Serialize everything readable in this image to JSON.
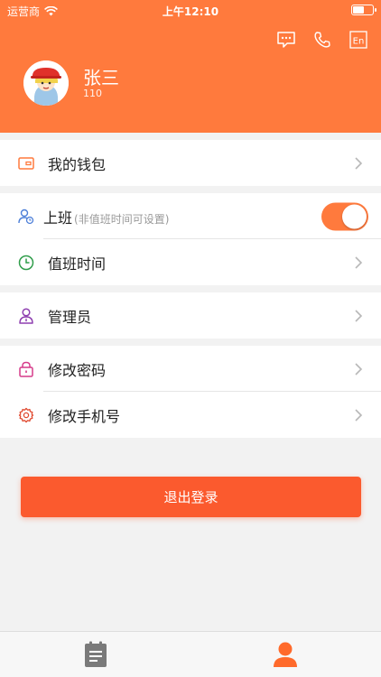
{
  "status_bar": {
    "carrier": "运营商",
    "time": "上午12:10",
    "battery_level": 0.6
  },
  "header": {
    "icons": [
      "message-icon",
      "phone-icon",
      "language-icon"
    ],
    "language_label": "En",
    "user": {
      "name": "张三",
      "id": "110"
    }
  },
  "menu": {
    "wallet": {
      "label": "我的钱包"
    },
    "on_duty": {
      "label": "上班",
      "hint": "(非值班时间可设置)",
      "toggle_on": true
    },
    "duty_time": {
      "label": "值班时间"
    },
    "admin": {
      "label": "管理员"
    },
    "change_password": {
      "label": "修改密码"
    },
    "change_phone": {
      "label": "修改手机号"
    }
  },
  "logout": {
    "label": "退出登录"
  },
  "tabbar": {
    "active": "profile",
    "tabs": [
      "orders-icon",
      "profile-icon"
    ]
  },
  "colors": {
    "accent": "#ff7a3d",
    "logout": "#fb5a2e",
    "background": "#f2f2f2"
  }
}
